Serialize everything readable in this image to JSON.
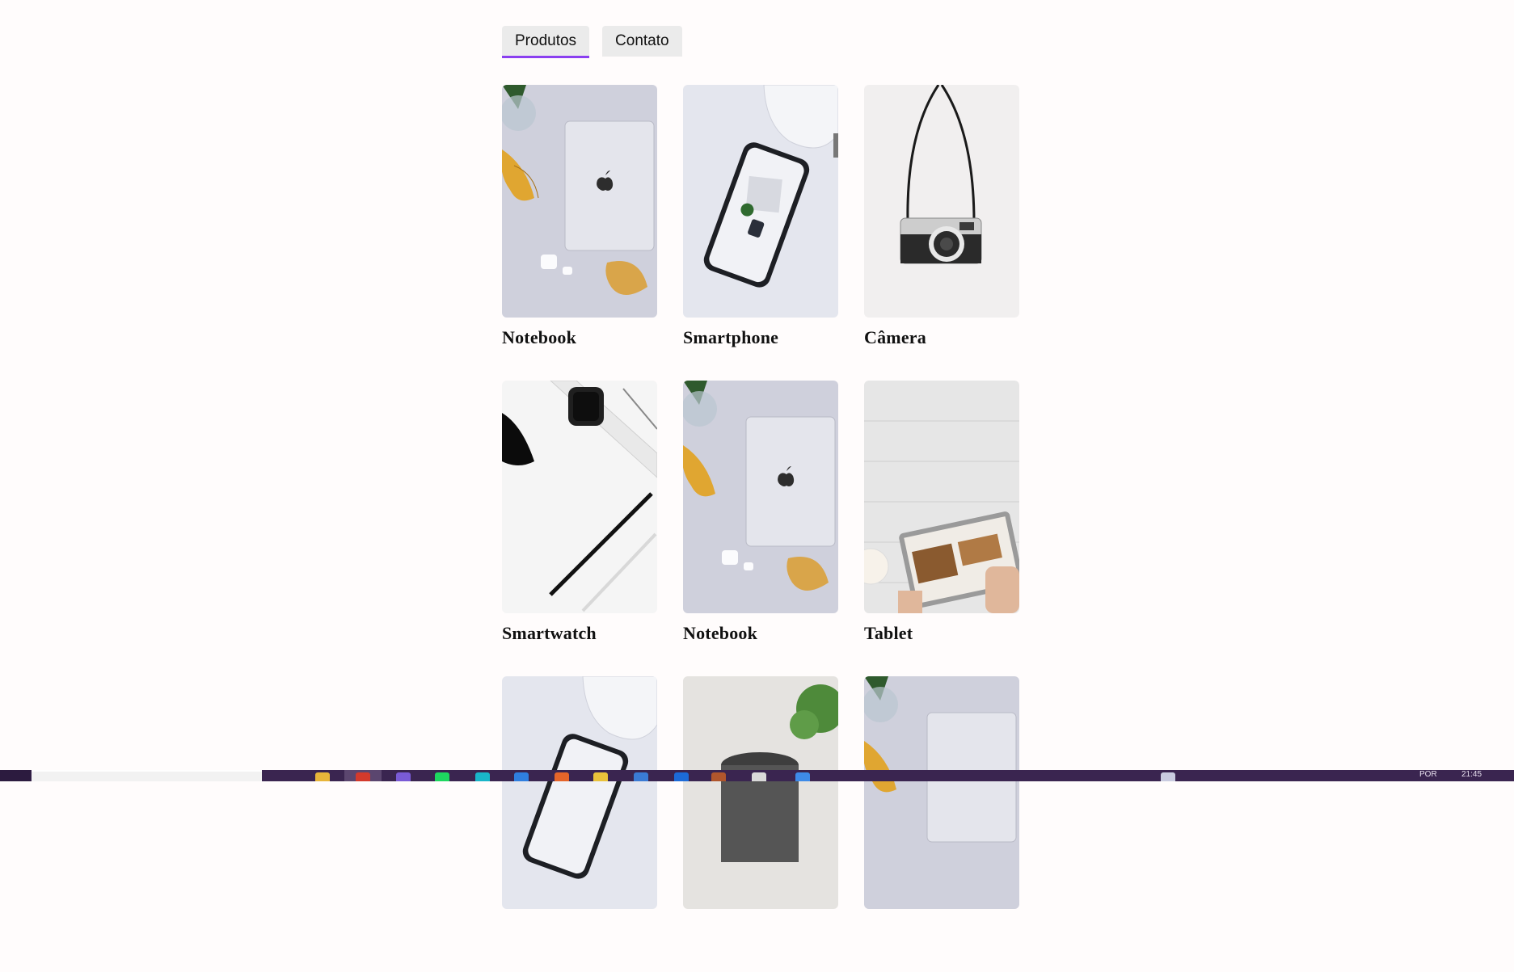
{
  "nav": {
    "tabs": [
      {
        "label": "Produtos",
        "active": true
      },
      {
        "label": "Contato",
        "active": false
      }
    ]
  },
  "products": [
    {
      "name": "Notebook",
      "image": "laptop-photo"
    },
    {
      "name": "Smartphone",
      "image": "smartphone-photo"
    },
    {
      "name": "Câmera",
      "image": "camera-photo"
    },
    {
      "name": "Smartwatch",
      "image": "smartwatch-photo"
    },
    {
      "name": "Notebook",
      "image": "laptop-photo"
    },
    {
      "name": "Tablet",
      "image": "tablet-photo"
    },
    {
      "name": "",
      "image": "smartphone-photo"
    },
    {
      "name": "",
      "image": "smart-speaker-photo"
    },
    {
      "name": "",
      "image": "laptop-photo"
    }
  ],
  "taskbar": {
    "language": "POR",
    "time": "21:45"
  },
  "colors": {
    "accent": "#8a3ff0",
    "tab_bg": "#ebebeb",
    "page_bg": "#fffcfc",
    "taskbar_bg": "#3a2550"
  }
}
